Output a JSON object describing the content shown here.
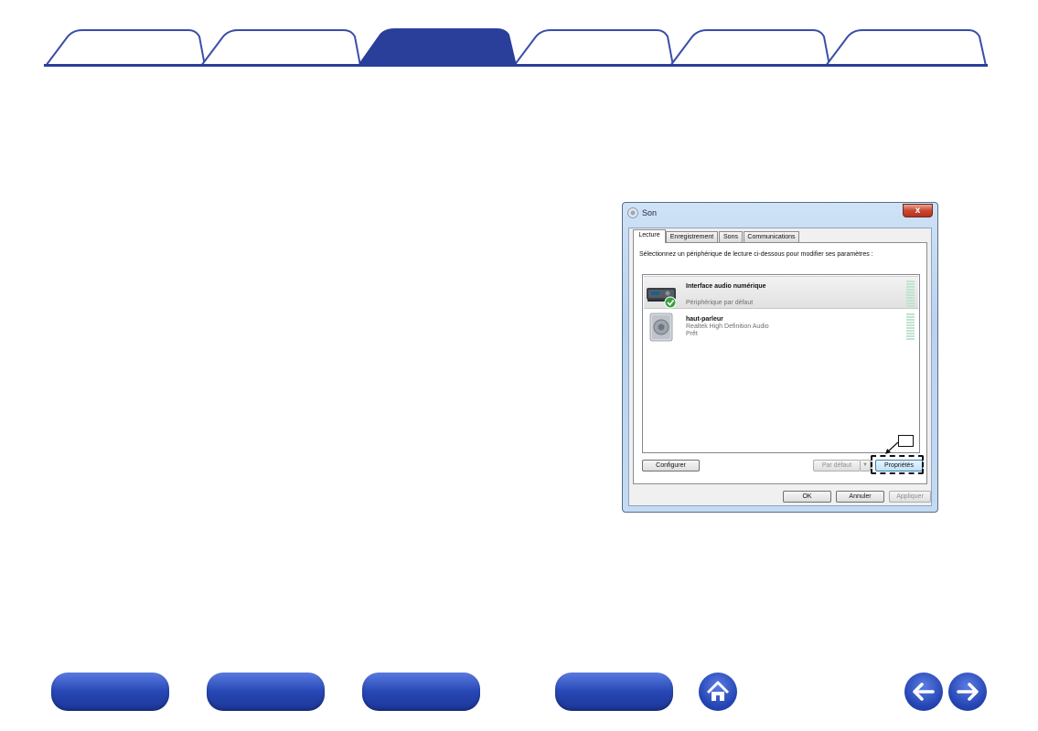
{
  "top_tabs": [
    {
      "label": "",
      "active": false
    },
    {
      "label": "",
      "active": false
    },
    {
      "label": "",
      "active": true
    },
    {
      "label": "",
      "active": false
    },
    {
      "label": "",
      "active": false
    },
    {
      "label": "",
      "active": false
    }
  ],
  "dialog": {
    "title": "Son",
    "close_glyph": "x",
    "tabs": [
      "Lecture",
      "Enregistrement",
      "Sons",
      "Communications"
    ],
    "active_tab": "Lecture",
    "instruction": "Sélectionnez un périphérique de lecture ci-dessous pour modifier ses paramètres :",
    "devices": [
      {
        "name": "Interface audio numérique",
        "line1": "",
        "line2": "Périphérique par défaut",
        "selected": true,
        "icon": "digital-audio-interface-icon"
      },
      {
        "name": "haut-parleur",
        "line1": "Realtek High Definition Audio",
        "line2": "Prêt",
        "selected": false,
        "icon": "speaker-icon"
      }
    ],
    "buttons": {
      "configure": "Configurer",
      "default": "Par défaut",
      "properties": "Propriétés",
      "ok": "OK",
      "cancel": "Annuler",
      "apply": "Appliquer"
    },
    "callout_number": ""
  },
  "bottom_nav": {
    "buttons": [
      "",
      "",
      "",
      ""
    ],
    "icons": [
      "home-icon",
      "arrow-left-icon",
      "arrow-right-icon"
    ]
  },
  "colors": {
    "tab_active": "#2a3f9a",
    "tab_outline": "#3a4ea8",
    "nav_blue": "#2747b5"
  }
}
